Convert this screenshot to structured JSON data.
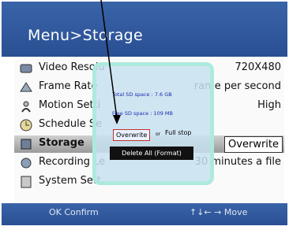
{
  "header": {
    "title": "Menu>Storage"
  },
  "menu": [
    {
      "label": "Video Resolu",
      "value": "720X480",
      "icon": "video-icon"
    },
    {
      "label": "Frame Rate",
      "value": "rame per second",
      "icon": "frame-rate-icon"
    },
    {
      "label": "Motion Setti",
      "value": "High",
      "icon": "motion-icon"
    },
    {
      "label": "Schedule Se",
      "value": "",
      "icon": "schedule-icon"
    },
    {
      "label": "Storage",
      "value": "Overwrite",
      "icon": "storage-icon"
    },
    {
      "label": "Recording Le",
      "value": "30 minutes a file",
      "icon": "recording-icon"
    },
    {
      "label": "System Sett",
      "value": "",
      "icon": "system-icon"
    }
  ],
  "popup": {
    "total": "Total SD space : 7.6 GB",
    "free": "Free SD space : 109 MB",
    "option_overwrite": "Overwrite",
    "option_or": "or",
    "option_fullstop": "Full stop",
    "format_button": "Delete All (Format)"
  },
  "footer": {
    "confirm": "OK Confirm",
    "move": "↑↓← → Move"
  },
  "colors": {
    "header": "#2f569a",
    "selected_row": "#a8a8a8",
    "popup_border": "#aaebdc",
    "format_bar": "#111111"
  }
}
